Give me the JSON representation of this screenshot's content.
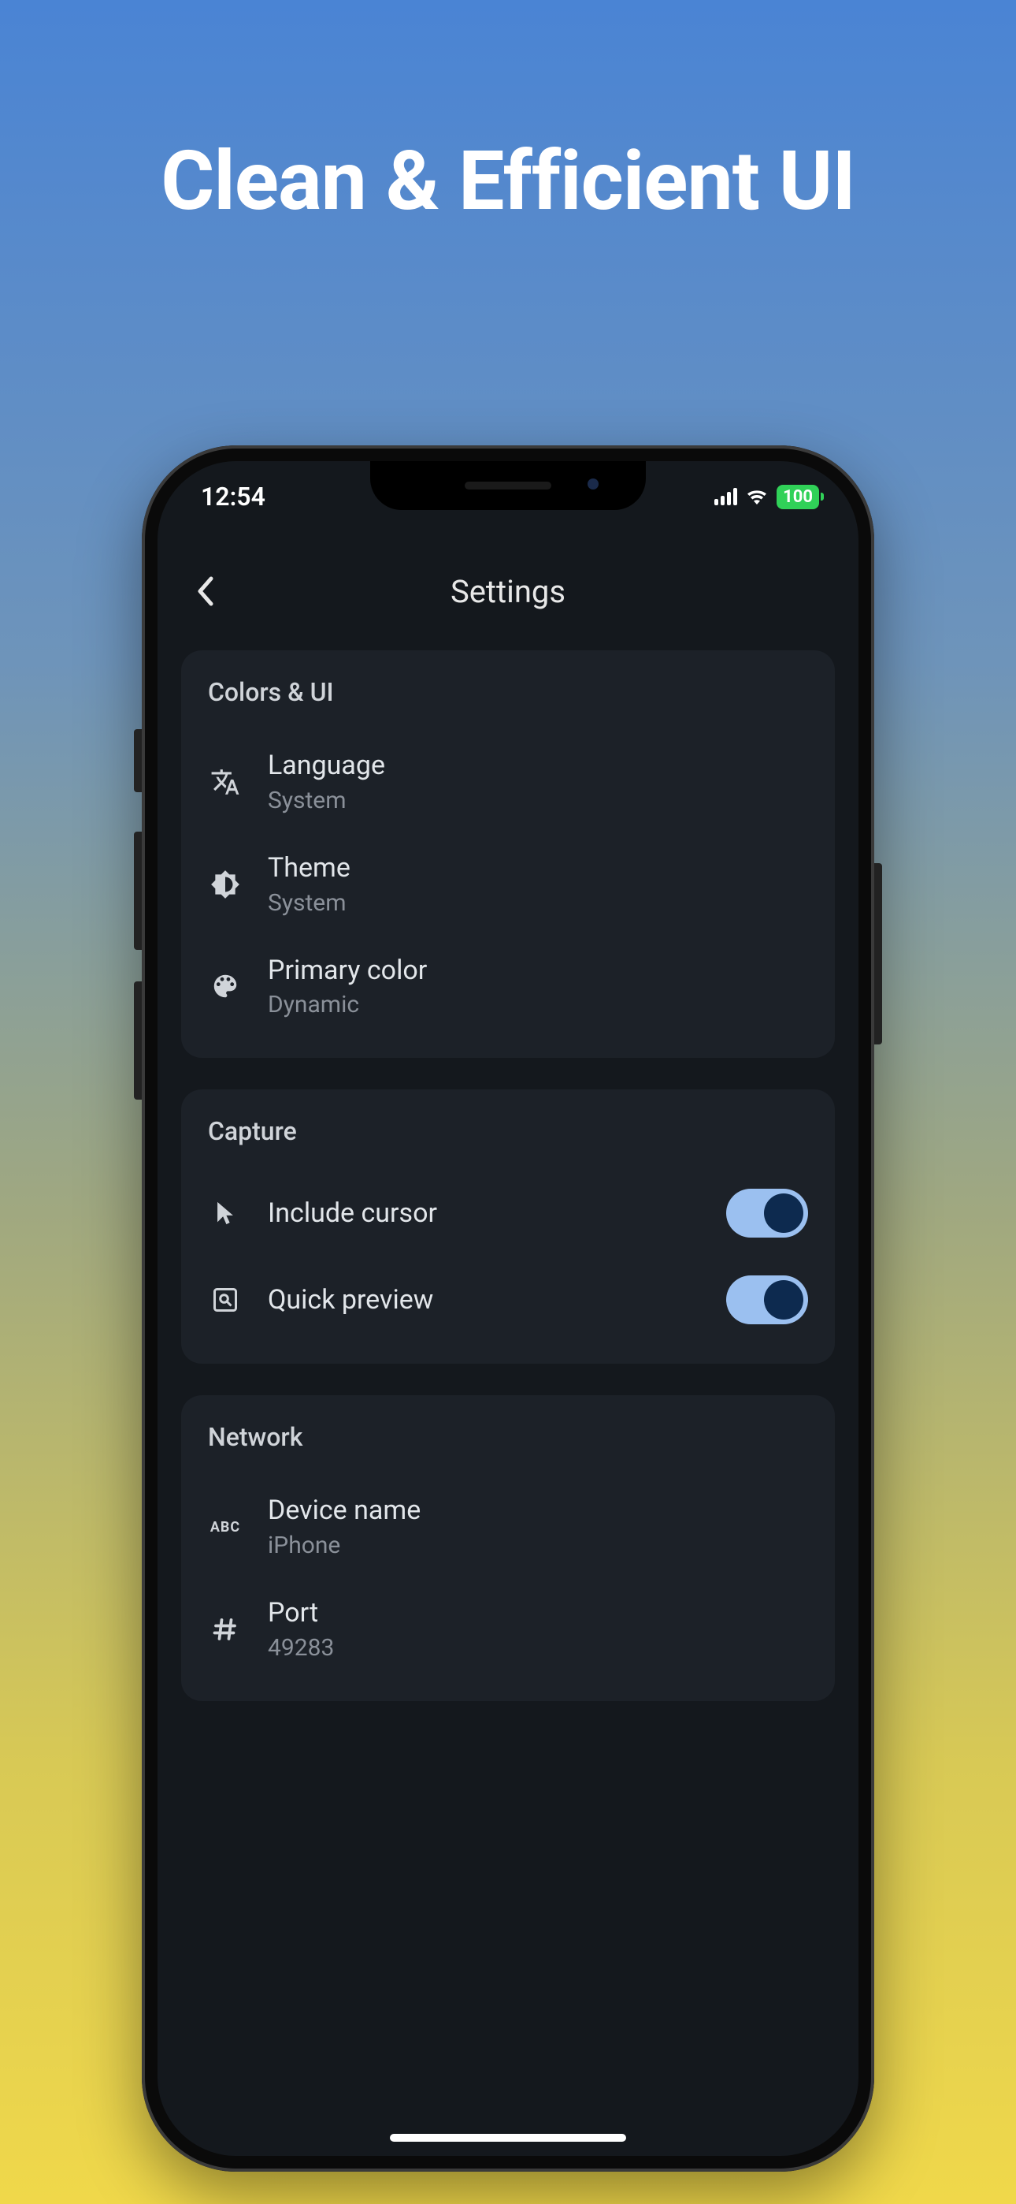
{
  "marketing": {
    "headline": "Clean & Efficient UI"
  },
  "status": {
    "time": "12:54",
    "battery": "100"
  },
  "nav": {
    "title": "Settings"
  },
  "sections": {
    "colors": {
      "title": "Colors & UI",
      "language": {
        "label": "Language",
        "value": "System"
      },
      "theme": {
        "label": "Theme",
        "value": "System"
      },
      "primary": {
        "label": "Primary color",
        "value": "Dynamic"
      }
    },
    "capture": {
      "title": "Capture",
      "cursor": {
        "label": "Include cursor",
        "on": true
      },
      "preview": {
        "label": "Quick preview",
        "on": true
      }
    },
    "network": {
      "title": "Network",
      "device": {
        "label": "Device name",
        "value": "iPhone"
      },
      "port": {
        "label": "Port",
        "value": "49283"
      }
    }
  },
  "colors": {
    "toggle_track": "#9bc0f0",
    "toggle_knob": "#0d2a4f",
    "accent_green": "#30d158"
  }
}
